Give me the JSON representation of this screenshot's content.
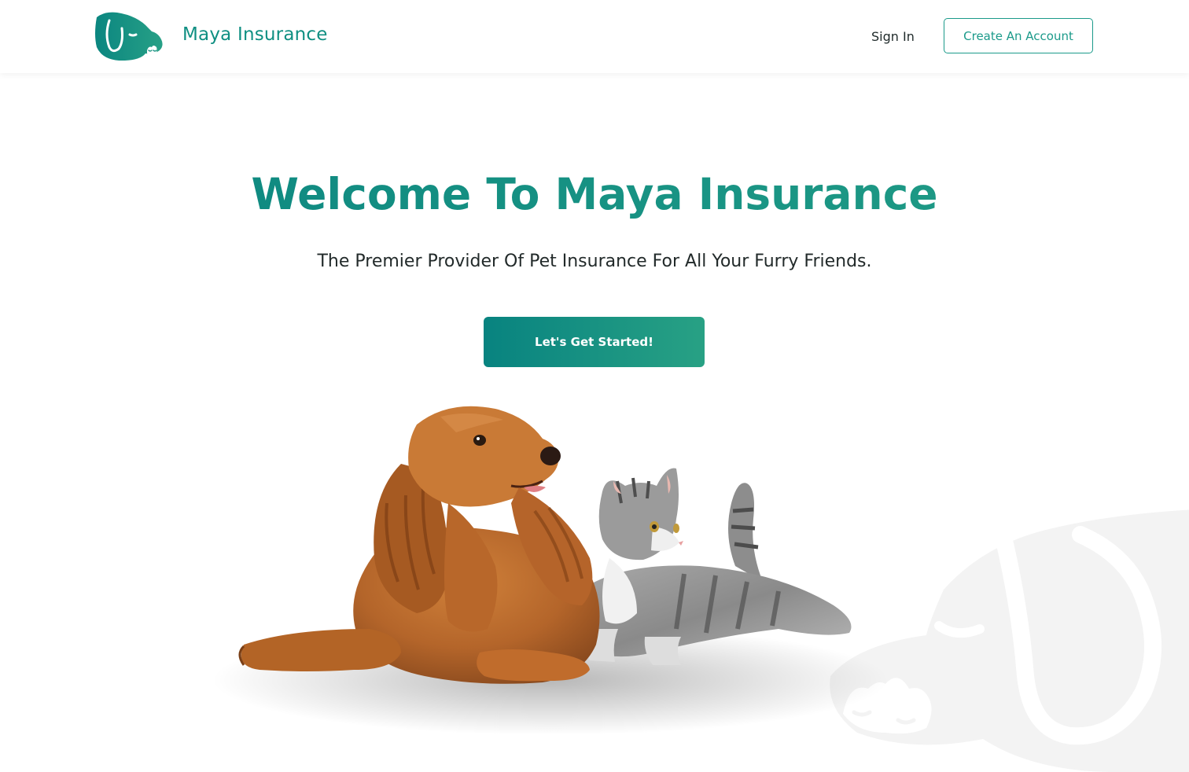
{
  "header": {
    "brand_name": "Maya Insurance",
    "nav": {
      "sign_in_label": "Sign In",
      "create_account_label": "Create An Account"
    }
  },
  "hero": {
    "title": "Welcome To Maya Insurance",
    "subtitle": "The Premier Provider Of Pet Insurance For All Your Furry Friends.",
    "cta_label": "Let's Get Started!"
  },
  "icons": {
    "logo": "maya-dog-logo-icon",
    "watermark": "maya-dog-watermark-icon"
  },
  "colors": {
    "brand": "#0f8f82",
    "brand_gradient_start": "#088380",
    "brand_gradient_end": "#28a184",
    "text_dark": "#1f2a2a",
    "watermark": "#f3f3f3"
  }
}
